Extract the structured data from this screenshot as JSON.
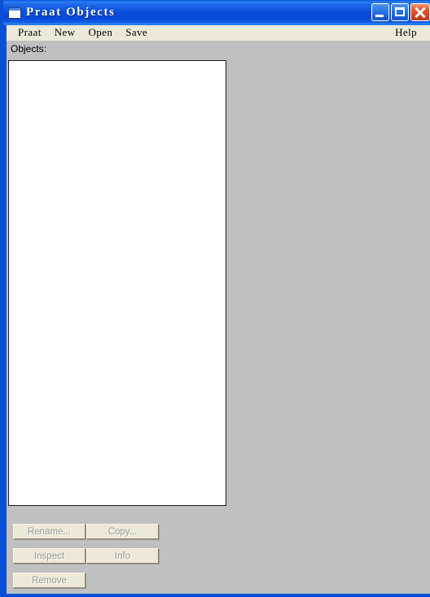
{
  "window": {
    "title": "Praat Objects",
    "icon": "window-document-icon",
    "frame_color": "#0a4fd8",
    "titlebar_color": "#0b51dd",
    "client_background": "#c0c0c0",
    "controls": [
      {
        "name": "minimize",
        "label": "_"
      },
      {
        "name": "maximize",
        "label": "□"
      },
      {
        "name": "close",
        "label": "×"
      }
    ]
  },
  "menubar": {
    "background": "#ece9d8",
    "left_items": [
      {
        "label": "Praat"
      },
      {
        "label": "New"
      },
      {
        "label": "Open"
      },
      {
        "label": "Save"
      }
    ],
    "right_items": [
      {
        "label": "Help"
      }
    ]
  },
  "main": {
    "objects_label": "Objects:",
    "list": {
      "items": [],
      "background": "#ffffff",
      "border_color": "#1c1c1c"
    },
    "buttons": [
      {
        "label": "Rename...",
        "name": "rename-button",
        "enabled": false
      },
      {
        "label": "Copy...",
        "name": "copy-button",
        "enabled": false
      },
      {
        "label": "Inspect",
        "name": "inspect-button",
        "enabled": false
      },
      {
        "label": "Info",
        "name": "info-button",
        "enabled": false
      },
      {
        "label": "Remove",
        "name": "remove-button",
        "enabled": false
      }
    ],
    "button_text_color": "#9b988c",
    "button_face_color": "#ece9d8"
  }
}
